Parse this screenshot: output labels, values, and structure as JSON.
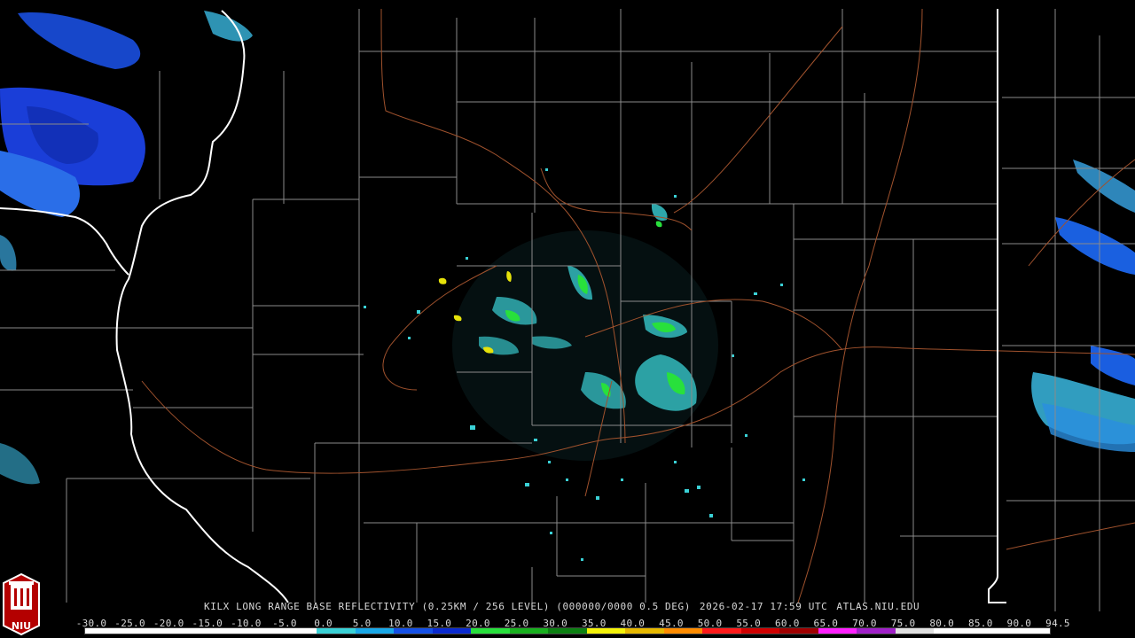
{
  "header": {
    "station": "KILX LONG RANGE BASE REFLECTIVITY (0.25KM / 256 LEVEL) (000000/0000 0.5 DEG)",
    "timestamp": "2026-02-17 17:59 UTC",
    "site": "ATLAS.NIU.EDU"
  },
  "logo": {
    "text": "NIU",
    "icon": "niu-logo-icon"
  },
  "colorscale": {
    "labels": [
      "-30.0",
      "-25.0",
      "-20.0",
      "-15.0",
      "-10.0",
      "-5.0",
      "0.0",
      "5.0",
      "10.0",
      "15.0",
      "20.0",
      "25.0",
      "30.0",
      "35.0",
      "40.0",
      "45.0",
      "50.0",
      "55.0",
      "60.0",
      "65.0",
      "70.0",
      "75.0",
      "80.0",
      "85.0",
      "90.0",
      "94.5"
    ],
    "colors": [
      "#ffffff",
      "#ffffff",
      "#ffffff",
      "#ffffff",
      "#ffffff",
      "#ffffff",
      "#3ad1d6",
      "#19a8e8",
      "#1450e6",
      "#0a2ad0",
      "#28e03c",
      "#18b01e",
      "#0c8012",
      "#f4f20a",
      "#e6b800",
      "#ff8c00",
      "#ff1a1a",
      "#d00000",
      "#a00000",
      "#ff20ff",
      "#a020c8",
      "#e0e0e0",
      "#ffffff",
      "#ffffff",
      "#ffffff"
    ]
  },
  "map": {
    "state_border_color": "#ffffff",
    "county_line_color": "#8a8a8a",
    "road_color": "#a0522d",
    "echo_light": "#3ad1d6",
    "echo_mid": "#1450e6",
    "echo_green": "#28e03c",
    "echo_yellow": "#e6e20a"
  }
}
